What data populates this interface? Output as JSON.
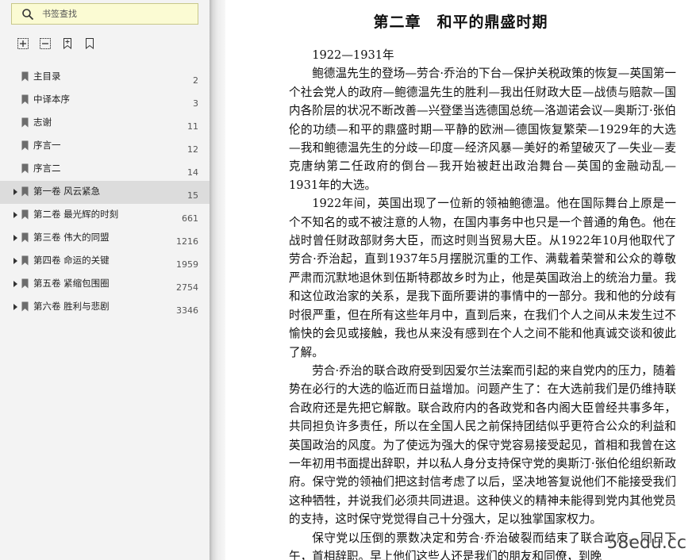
{
  "sidebar": {
    "search": {
      "placeholder": "书签查找",
      "icon": "search-icon"
    },
    "tools": [
      "expand-all-icon",
      "collapse-all-icon",
      "add-bookmark-icon",
      "bookmark-icon"
    ],
    "items": [
      {
        "label": "主目录",
        "page": "2",
        "expandable": false,
        "selected": false
      },
      {
        "label": "中译本序",
        "page": "3",
        "expandable": false,
        "selected": false
      },
      {
        "label": "志谢",
        "page": "11",
        "expandable": false,
        "selected": false
      },
      {
        "label": "序言一",
        "page": "12",
        "expandable": false,
        "selected": false
      },
      {
        "label": "序言二",
        "page": "14",
        "expandable": false,
        "selected": false
      },
      {
        "label": "第一卷  风云紧急",
        "page": "15",
        "expandable": true,
        "selected": true
      },
      {
        "label": "第二卷  最光辉的时刻",
        "page": "661",
        "expandable": true,
        "selected": false
      },
      {
        "label": "第三卷  伟大的同盟",
        "page": "1216",
        "expandable": true,
        "selected": false
      },
      {
        "label": "第四卷  命运的关键",
        "page": "1959",
        "expandable": true,
        "selected": false
      },
      {
        "label": "第五卷  紧缩包围圈",
        "page": "2754",
        "expandable": true,
        "selected": false
      },
      {
        "label": "第六卷  胜利与悲剧",
        "page": "3346",
        "expandable": true,
        "selected": false
      }
    ]
  },
  "page": {
    "chapter_title": "第二章　和平的鼎盛时期",
    "paragraphs": [
      "1922—1931年",
      "鲍德温先生的登场—劳合·乔治的下台—保护关税政策的恢复—英国第一个社会党人的政府—鲍德温先生的胜利—我出任财政大臣—战债与赔款—国内各阶层的状况不断改善—兴登堡当选德国总统—洛迦诺会议—奥斯汀·张伯伦的功绩—和平的鼎盛时期—平静的欧洲—德国恢复繁荣—1929年的大选—我和鲍德温先生的分歧—印度—经济风暴—美好的希望破灭了—失业—麦克唐纳第二任政府的倒台—我开始被赶出政治舞台—英国的金融动乱—1931年的大选。",
      "1922年间，英国出现了一位新的领袖鲍德温。他在国际舞台上原是一个不知名的或不被注意的人物，在国内事务中也只是一个普通的角色。他在战时曾任财政部财务大臣，而这时则当贸易大臣。从1922年10月他取代了劳合·乔治起，直到1937年5月摆脱沉重的工作、满载着荣誉和公众的尊敬严肃而沉默地退休到伍斯特郡故乡时为止，他是英国政治上的统治力量。我和这位政治家的关系，是我下面所要讲的事情中的一部分。我和他的分歧有时很严重，但在所有这些年月中，直到后来，在我们个人之间从未发生过不愉快的会见或接触，我也从来没有感到在个人之间不能和他真诚交谈和彼此了解。",
      "劳合·乔治的联合政府受到因爱尔兰法案而引起的来自党内的压力，随着势在必行的大选的临近而日益增加。问题产生了：在大选前我们是仍维持联合政府还是先把它解散。联合政府内的各政党和各内阁大臣曾经共事多年，共同担负许多责任，所以在全国人民之前保持团结似乎更符合公众的利益和英国政治的风度。为了使远为强大的保守党容易接受起见，首相和我曾在这一年初用书面提出辞职，并以私人身分支持保守党的奥斯汀·张伯伦组织新政府。保守党的领袖们把这封信考虑了以后，坚决地答复说他们不能接受我们这种牺牲，并说我们必须共同进退。这种侠义的精神未能得到党内其他党员的支持，这时保守党觉得自己十分强大，足以独掌国家权力。",
      "保守党以压倒的票数决定和劳合·乔治破裂而结束了联合政府。同日下午，首相辞职。早上他们这些人还是我们的朋友和同僚，到晚"
    ]
  },
  "watermark": "58edu.cc"
}
